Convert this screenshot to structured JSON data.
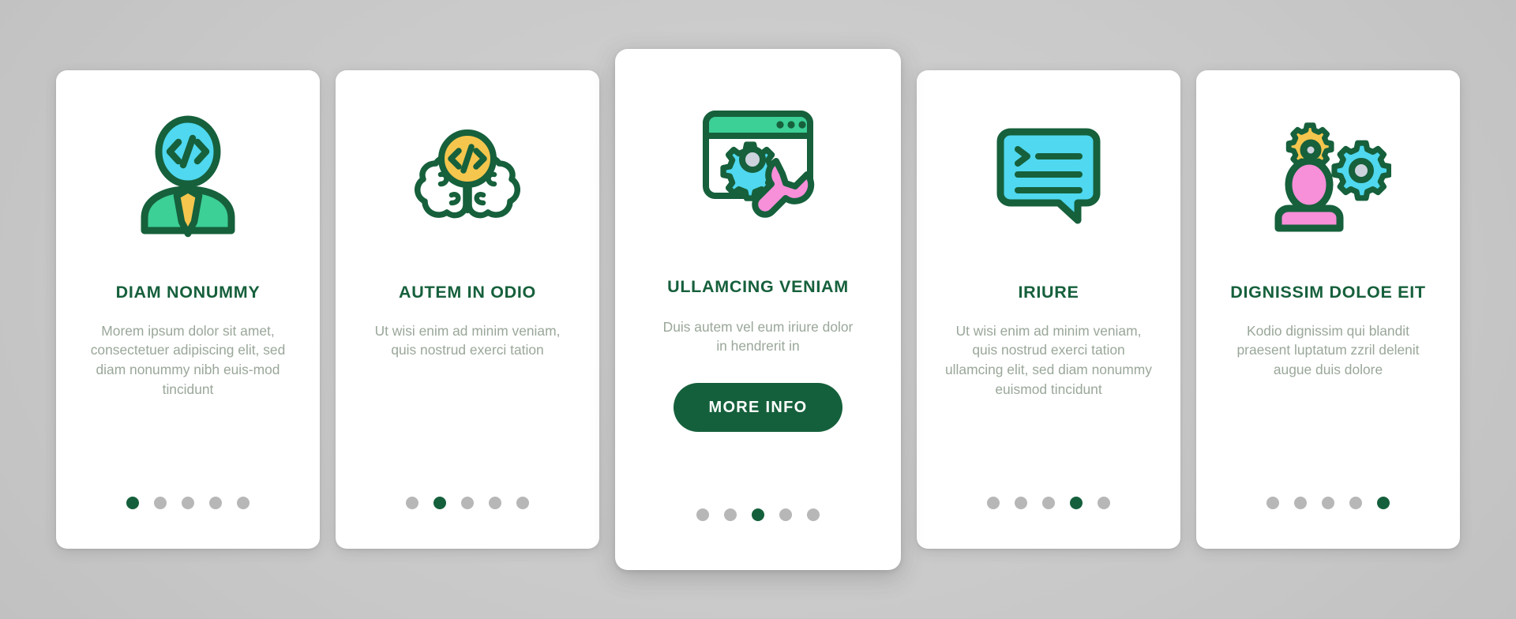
{
  "theme": {
    "background": "#c9c9c9",
    "card_background": "#ffffff",
    "title_color": "#16603c",
    "body_color": "#9aa79a",
    "accent_green": "#15603c",
    "dot_inactive": "#b7b7b7",
    "icon_outline": "#16603c",
    "icon_cyan": "#4fd8ef",
    "icon_green": "#3ccf96",
    "icon_yellow": "#f5c64d",
    "icon_pink": "#f78fd9",
    "icon_grey": "#cdd3dd"
  },
  "cards": [
    {
      "id": "card-diam-nonummy",
      "icon_name": "programmer-code-person-icon",
      "title": "DIAM NONUMMY",
      "body": "Morem ipsum dolor sit amet, consectetuer adipiscing elit, sed diam nonummy nibh euis-mod tincidunt",
      "featured": false,
      "dots": {
        "count": 5,
        "active_index": 0
      },
      "cta": null
    },
    {
      "id": "card-autem-in-odio",
      "icon_name": "brain-code-icon",
      "title": "AUTEM IN ODIO",
      "body": "Ut wisi enim ad minim veniam, quis nostrud exerci tation",
      "featured": false,
      "dots": {
        "count": 5,
        "active_index": 1
      },
      "cta": null
    },
    {
      "id": "card-ullamcing-veniam",
      "icon_name": "browser-gear-wrench-icon",
      "title": "ULLAMCING VENIAM",
      "body": "Duis autem vel eum iriure dolor in hendrerit in",
      "featured": true,
      "dots": {
        "count": 5,
        "active_index": 2
      },
      "cta": "MORE INFO"
    },
    {
      "id": "card-iriure",
      "icon_name": "chat-terminal-bubble-icon",
      "title": "IRIURE",
      "body": "Ut wisi enim ad minim veniam, quis nostrud exerci tation ullamcing elit, sed diam nonummy euismod tincidunt",
      "featured": false,
      "dots": {
        "count": 5,
        "active_index": 3
      },
      "cta": null
    },
    {
      "id": "card-dignissim-doloe-eit",
      "icon_name": "person-gears-settings-icon",
      "title": "DIGNISSIM DOLOE EIT",
      "body": "Kodio dignissim qui blandit praesent luptatum zzril delenit augue duis dolore",
      "featured": false,
      "dots": {
        "count": 5,
        "active_index": 4
      },
      "cta": null
    }
  ]
}
